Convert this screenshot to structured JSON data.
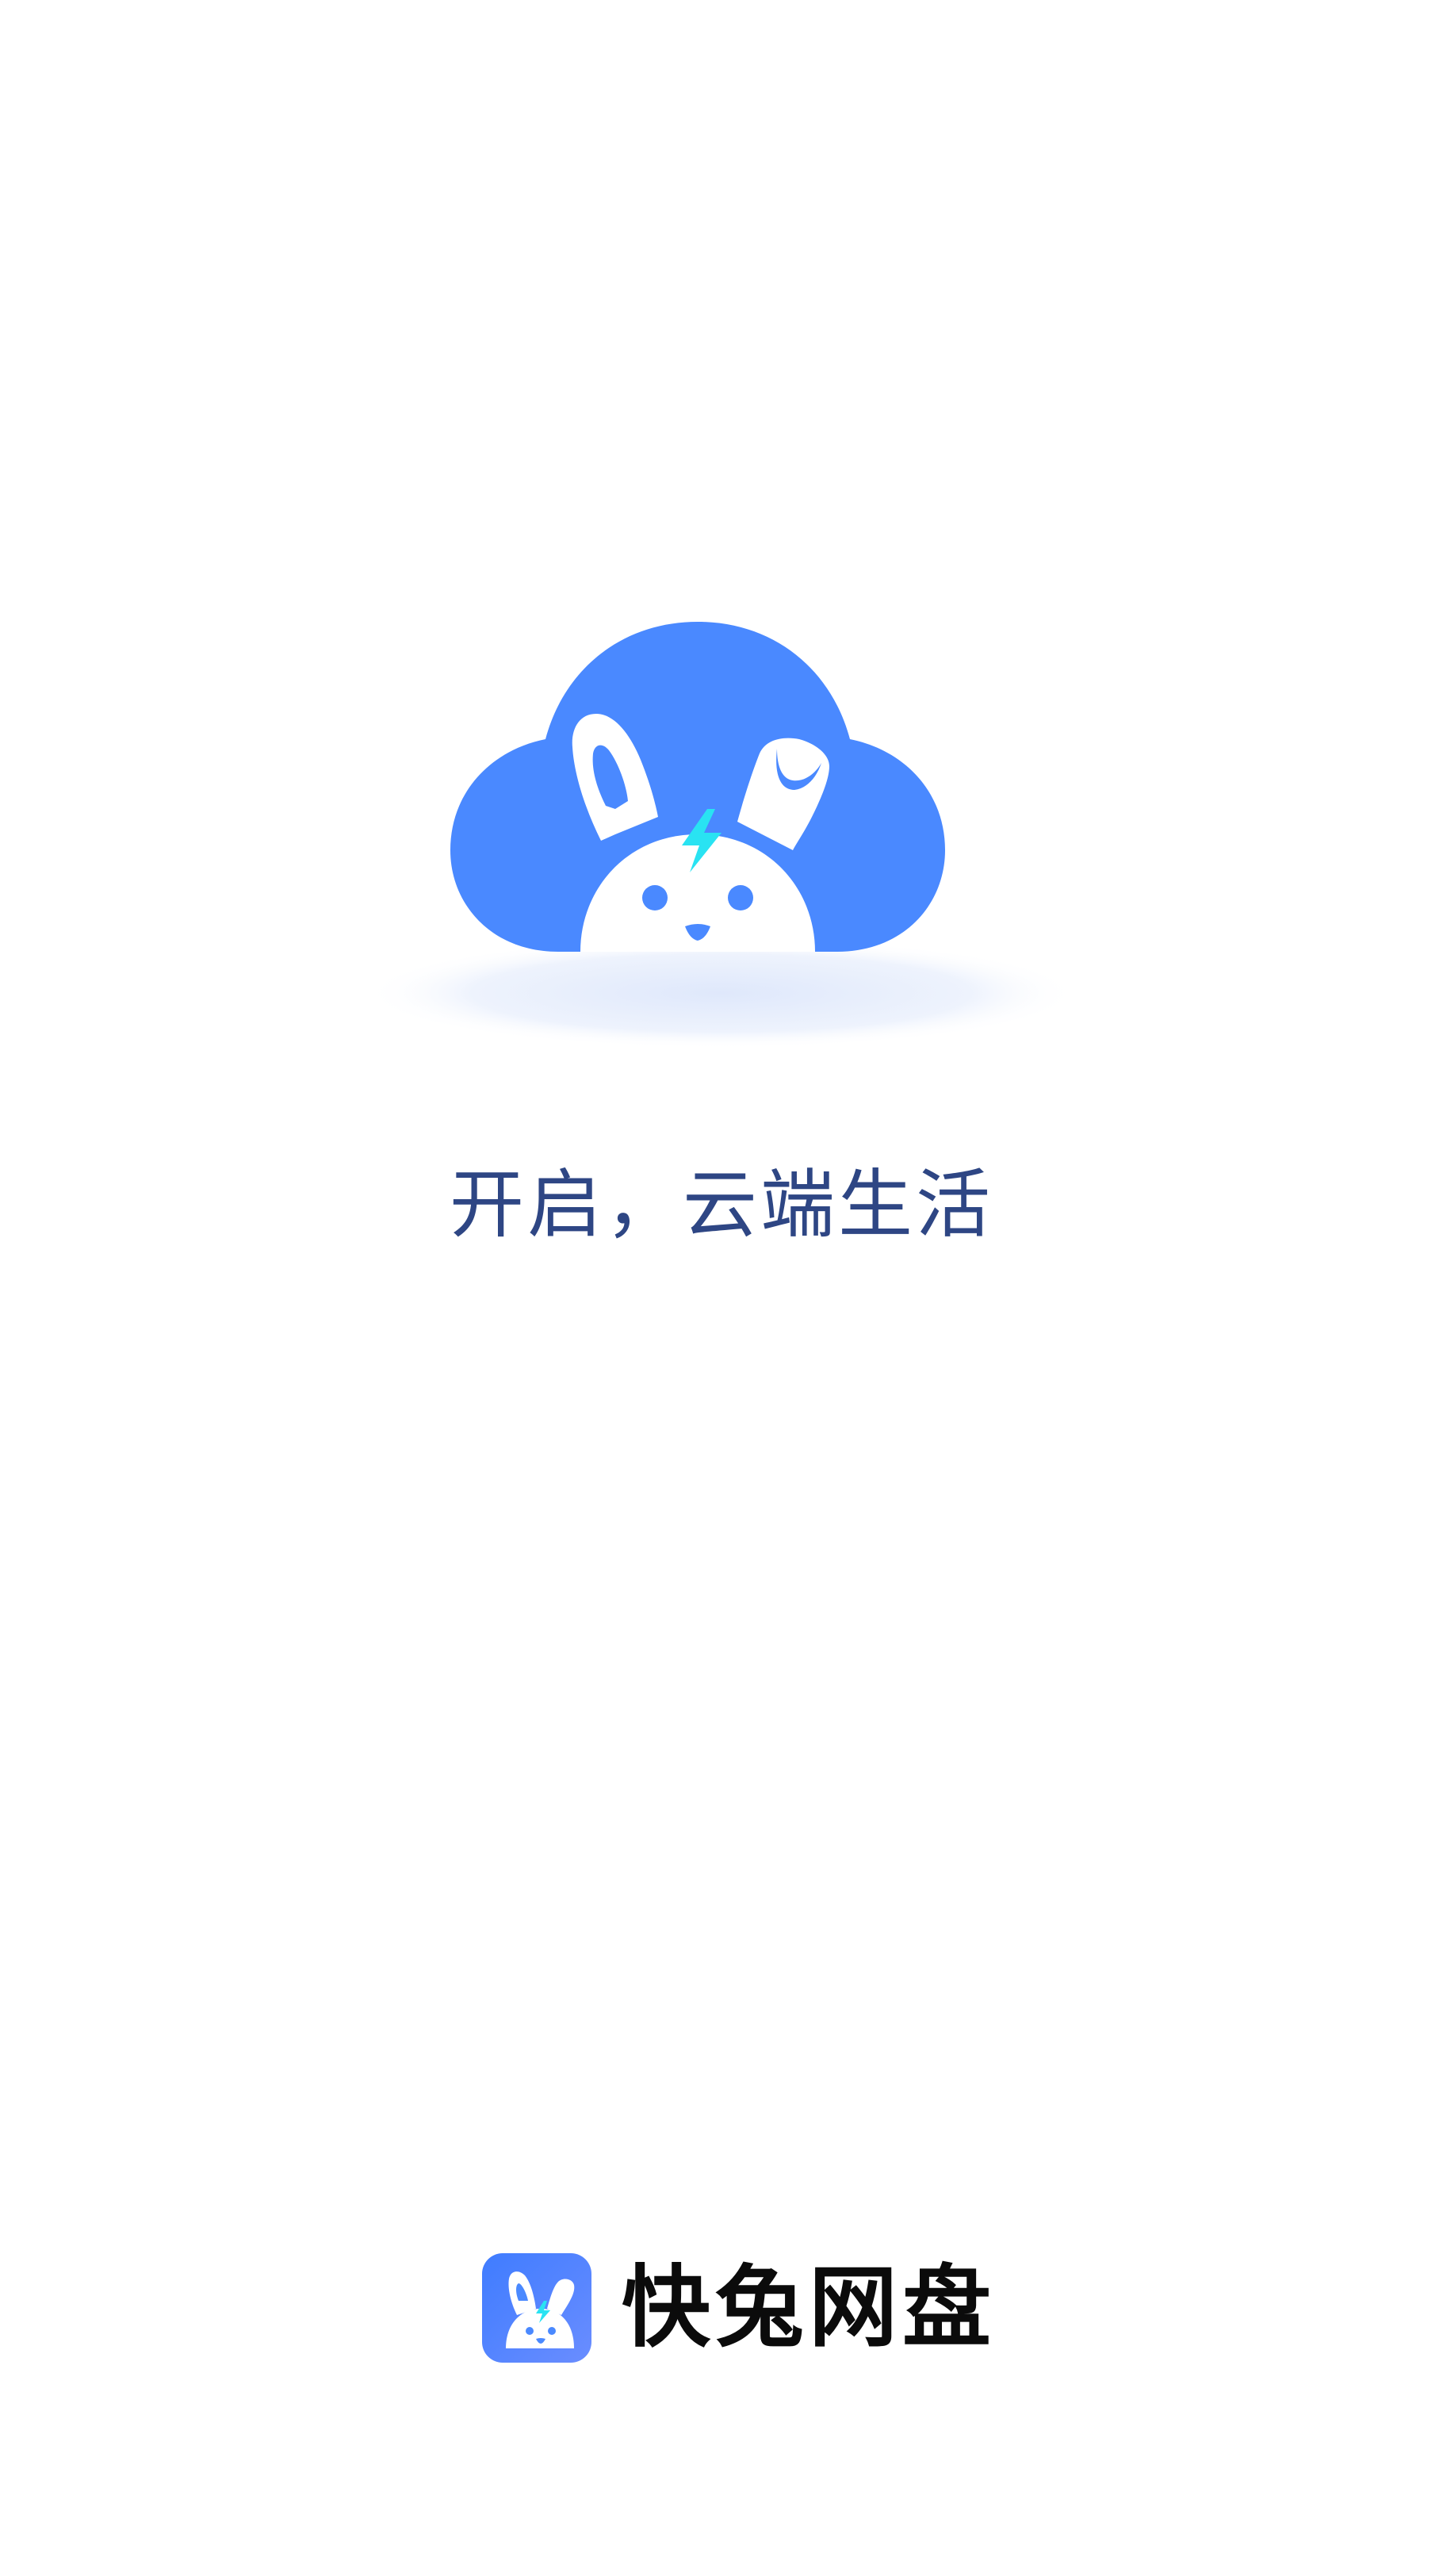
{
  "splash": {
    "slogan": "开启，云端生活",
    "illustration_icon": "cloud-rabbit-icon"
  },
  "brand": {
    "name": "快兔网盘",
    "logo_icon": "rabbit-app-icon"
  },
  "colors": {
    "cloud": "#4a89ff",
    "slogan_text": "#2e4684",
    "brand_text": "#0b0b0b",
    "bolt": "#29e3f2",
    "background": "#ffffff"
  }
}
